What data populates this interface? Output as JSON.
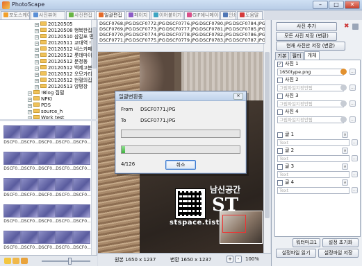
{
  "window": {
    "title": "PhotoScape",
    "min_label": "–",
    "max_label": "□",
    "close_label": "✕"
  },
  "tabs": [
    {
      "label": "포토스케이프",
      "color": "#f2a02b"
    },
    {
      "label": "사진뷰어",
      "color": "#5a8fd6"
    },
    {
      "label": "사진편집",
      "color": "#68b544"
    },
    {
      "label": "일괄편집",
      "color": "#e36b2a"
    },
    {
      "label": "페이지",
      "color": "#8b5bc6"
    },
    {
      "label": "이어붙이기",
      "color": "#3da5c2"
    },
    {
      "label": "GIF애니메이션",
      "color": "#d94f8a"
    },
    {
      "label": "인쇄",
      "color": "#5077b5"
    },
    {
      "label": "도움말",
      "color": "#d43a3a"
    }
  ],
  "tree": [
    {
      "label": "20120505",
      "level": 3
    },
    {
      "label": "20120508 행복한집",
      "level": 3
    },
    {
      "label": "20120510 삼길포 민",
      "level": 3
    },
    {
      "label": "20120511 교대역 !",
      "level": 3
    },
    {
      "label": "20120512 네스카페",
      "level": 3
    },
    {
      "label": "20120512 롯데마이",
      "level": 3
    },
    {
      "label": "20120512 문정동",
      "level": 3
    },
    {
      "label": "20120512 백제고분",
      "level": 3
    },
    {
      "label": "20120512 오모가리",
      "level": 3
    },
    {
      "label": "20120512 헌혈의집",
      "level": 3
    },
    {
      "label": "20120513 양평장",
      "level": 3
    },
    {
      "label": "!Blog 집필",
      "level": 2
    },
    {
      "label": "NPKI",
      "level": 2
    },
    {
      "label": "PDS",
      "level": 2
    },
    {
      "label": "source_h",
      "level": 2
    },
    {
      "label": "Work test",
      "level": 2
    }
  ],
  "thumbnails": [
    "DSCF0...",
    "DSCF0...",
    "DSCF0...",
    "DSCF0...",
    "DSCF0...",
    "DSCF0...",
    "DSCF0...",
    "DSCF0...",
    "DSCF0...",
    "DSCF0...",
    "DSCF0...",
    "DSCF0...",
    "DSCF0...",
    "DSCF0...",
    "DSCF0...",
    "DSCF0...",
    "DSCF0...",
    "DSCF0...",
    "DSCF0...",
    "DSCF0...",
    "DSCF0...",
    "DSCF0...",
    "DSCF0...",
    "DSCF0...",
    "DSCF0..."
  ],
  "file_list": [
    [
      "DSCF0768.JPG",
      "DSCF0769.JPG",
      "DSCF0770.JPG",
      "DSCF0771.JPG"
    ],
    [
      "DSCF0772.JPG",
      "DSCF0773.JPG",
      "DSCF0774.JPG",
      "DSCF0775.JPG"
    ],
    [
      "DSCF0776.JPG",
      "DSCF0777.JPG",
      "DSCF0778.JPG",
      "DSCF0779.JPG"
    ],
    [
      "DSCF0780.JPG",
      "DSCF0781.JPG",
      "DSCF0782.JPG",
      "DSCF0783.JPG"
    ],
    [
      "DSCF0784.JPG",
      "DSCF0785.JPG",
      "DSCF0786.JPG",
      "DSCF0787.JPG"
    ]
  ],
  "watermark": {
    "line1": "남신공간",
    "line2": "ST",
    "url": "stspace.tist"
  },
  "status": {
    "original": "원본 1650 x 1237",
    "converted": "변환 1650 x 1237",
    "zoom": "100%"
  },
  "right": {
    "add_photo": "사진 추가",
    "save_all": "모든 사진 저장 (변환)",
    "save_current": "현재 사진만 저장 (변환)",
    "tab_basic": "기본",
    "tab_filter": "필터",
    "tab_object": "개체",
    "photo_label_prefix": "사진",
    "photo_rows": [
      {
        "n": "1",
        "checked": true,
        "value": "1650type.png",
        "filled": true
      },
      {
        "n": "2",
        "checked": false,
        "value": "그림파일지정안됨",
        "filled": false
      },
      {
        "n": "3",
        "checked": false,
        "value": "그림파일지정안됨",
        "filled": false
      },
      {
        "n": "4",
        "checked": false,
        "value": "그림파일지정안됨",
        "filled": false
      }
    ],
    "text_label_prefix": "글",
    "text_rows": [
      {
        "n": "1",
        "placeholder": "Text"
      },
      {
        "n": "2",
        "placeholder": "Text"
      },
      {
        "n": "3",
        "placeholder": "Text"
      },
      {
        "n": "4",
        "placeholder": "Text"
      }
    ],
    "watermark_btn": "워터마크1",
    "reset_settings": "설정 초기화",
    "load_settings": "설정파일 읽기",
    "save_settings": "설정파일 저장"
  },
  "dialog": {
    "title": "일괄변환중",
    "from_label": "From",
    "from_value": "DSCF0771.JPG",
    "to_label": "To",
    "to_value": "DSCF0771.JPG",
    "progress_overall": 0,
    "progress_item": 0.03,
    "counter": "4/126",
    "cancel": "취소",
    "close": "✕"
  },
  "colors": {
    "accent": "#3d7bd0",
    "progress": "#3eb23e"
  }
}
